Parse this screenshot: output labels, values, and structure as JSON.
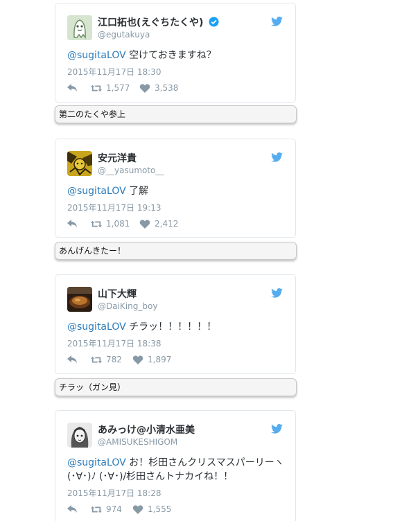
{
  "colors": {
    "mention": "#2b7bb9",
    "meta": "#8899a6",
    "twitter_bird": "#55acee",
    "verified": "#1da1f2"
  },
  "tweets": [
    {
      "name": "江口拓也(えぐちたくや)",
      "verified": true,
      "handle": "@egutakuya",
      "mention": "@sugitaLOV",
      "body": " 空けておきますね？",
      "date": "2015年11月17日 18:30",
      "retweets": "1,577",
      "likes": "3,538",
      "avatar_icon": "ghost-drawing-avatar",
      "comment": "第二のたくや参上"
    },
    {
      "name": "安元洋貴",
      "verified": false,
      "handle": "@__yasumoto__",
      "mention": "@sugitaLOV",
      "body": " 了解",
      "date": "2015年11月17日 19:13",
      "retweets": "1,081",
      "likes": "2,412",
      "avatar_icon": "yellow-illustration-avatar",
      "comment": "あんげんきたー！"
    },
    {
      "name": "山下大輝",
      "verified": false,
      "handle": "@DaiKing_boy",
      "mention": "@sugitaLOV",
      "body": " チラッ！！！！！！",
      "date": "2015年11月17日 18:38",
      "retweets": "782",
      "likes": "1,897",
      "avatar_icon": "food-photo-avatar",
      "comment": "チラッ（ガン見）"
    },
    {
      "name": "あみっけ@小清水亜美",
      "verified": false,
      "handle": "@AMISUKESHIGOM",
      "mention": "@sugitaLOV",
      "body": " お！杉田さんクリスマスパーリーヽ(･∀･)ﾉ (･∀･)/杉田さんトナカイね！！",
      "date": "2015年11月17日 18:28",
      "retweets": "974",
      "likes": "1,555",
      "avatar_icon": "sketch-portrait-avatar"
    }
  ]
}
